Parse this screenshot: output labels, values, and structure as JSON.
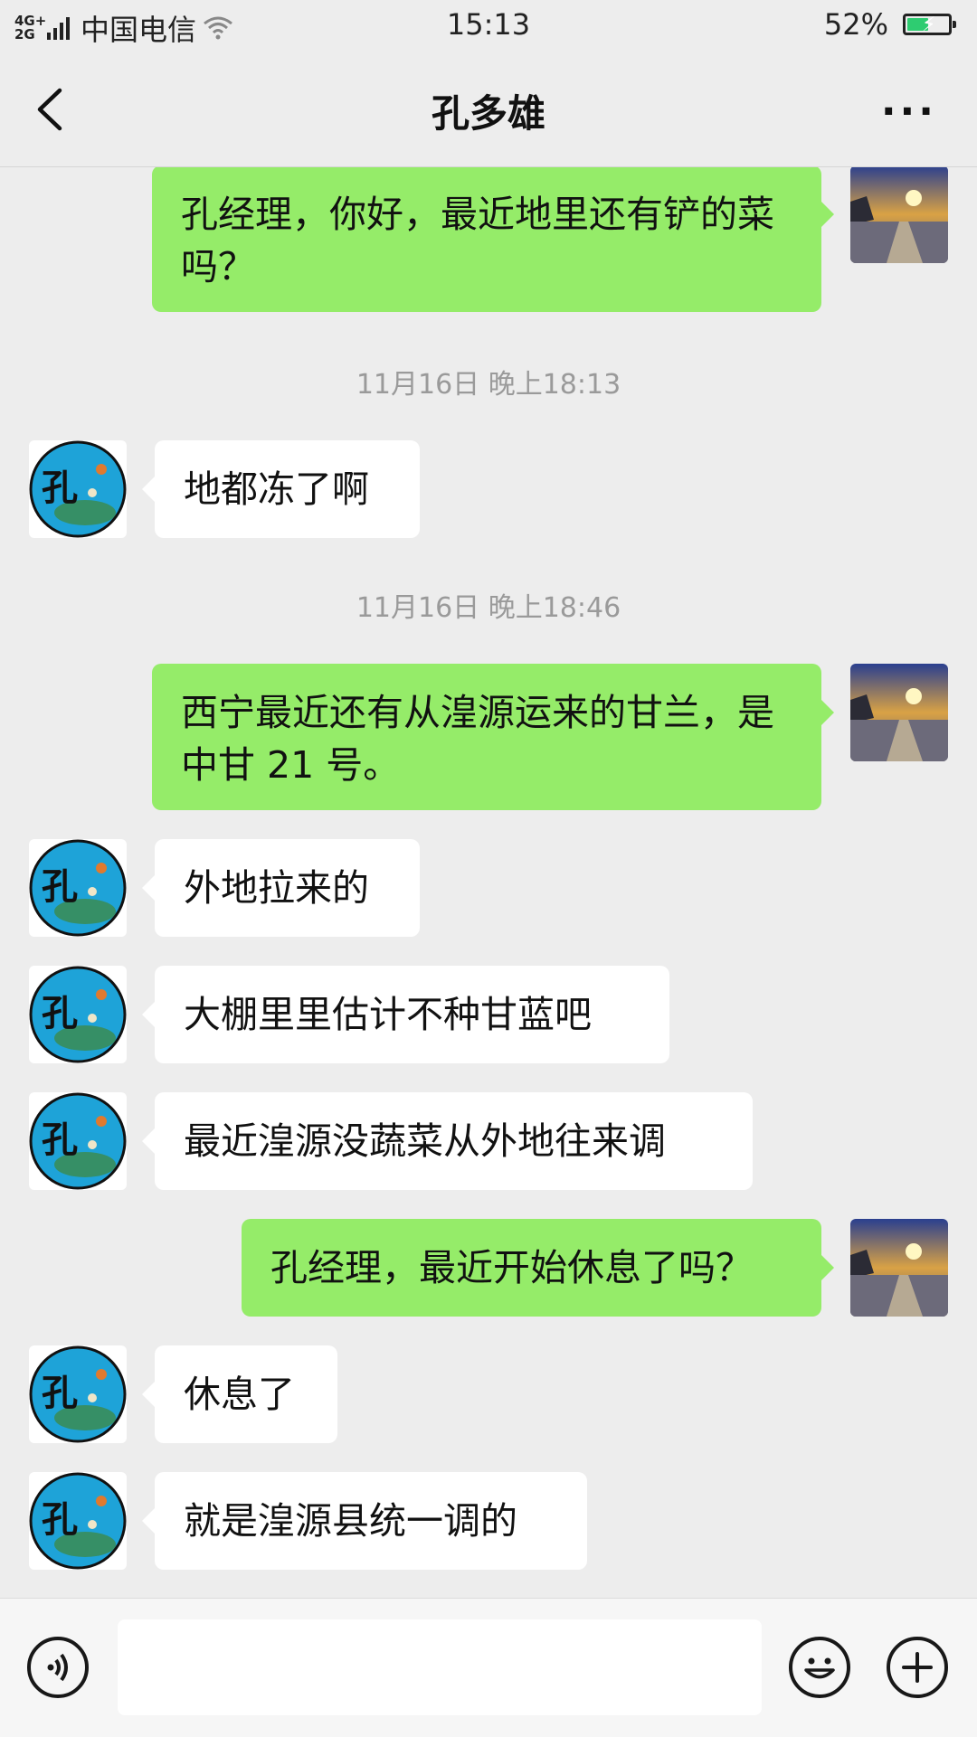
{
  "status_bar": {
    "network": "4G+\n2G",
    "carrier": "中国电信",
    "time": "15:13",
    "battery": "52%",
    "battery_level": 0.52
  },
  "header": {
    "title": "孔多雄"
  },
  "messages": [
    {
      "side": "right",
      "text": "孔经理，你好，最近地里还有铲的菜吗？"
    },
    {
      "type": "timestamp",
      "text": "11月16日 晚上18:13"
    },
    {
      "side": "left",
      "text": "地都冻了啊"
    },
    {
      "type": "timestamp",
      "text": "11月16日 晚上18:46"
    },
    {
      "side": "right",
      "text": "西宁最近还有从湟源运来的甘兰，是中甘 21 号。"
    },
    {
      "side": "left",
      "text": "外地拉来的"
    },
    {
      "side": "left",
      "text": "大棚里里估计不种甘蓝吧"
    },
    {
      "side": "left",
      "text": "最近湟源没蔬菜从外地往来调"
    },
    {
      "side": "right",
      "text": "孔经理，最近开始休息了吗？"
    },
    {
      "side": "left",
      "text": "休息了"
    },
    {
      "side": "left",
      "text": "就是湟源县统一调的"
    }
  ],
  "avatars": {
    "contact_glyph": "孔"
  },
  "input_bar": {
    "voice_icon": "voice-icon",
    "emoji_icon": "emoji-icon",
    "plus_icon": "plus-icon"
  },
  "colors": {
    "background": "#ededed",
    "sent_bubble": "#95ec69",
    "received_bubble": "#ffffff"
  }
}
